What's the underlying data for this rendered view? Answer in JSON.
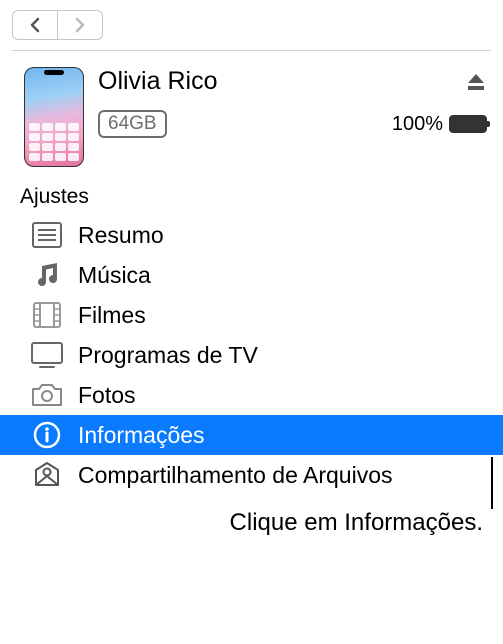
{
  "device": {
    "name": "Olivia Rico",
    "storage": "64GB",
    "battery_text": "100%"
  },
  "section_header": "Ajustes",
  "sidebar": {
    "items": [
      {
        "label": "Resumo",
        "icon": "summary-icon",
        "selected": false
      },
      {
        "label": "Música",
        "icon": "music-icon",
        "selected": false
      },
      {
        "label": "Filmes",
        "icon": "movies-icon",
        "selected": false
      },
      {
        "label": "Programas de TV",
        "icon": "tv-icon",
        "selected": false
      },
      {
        "label": "Fotos",
        "icon": "photos-icon",
        "selected": false
      },
      {
        "label": "Informações",
        "icon": "info-icon",
        "selected": true
      },
      {
        "label": "Compartilhamento de Arquivos",
        "icon": "file-sharing-icon",
        "selected": false
      }
    ]
  },
  "caption": "Clique em Informações."
}
